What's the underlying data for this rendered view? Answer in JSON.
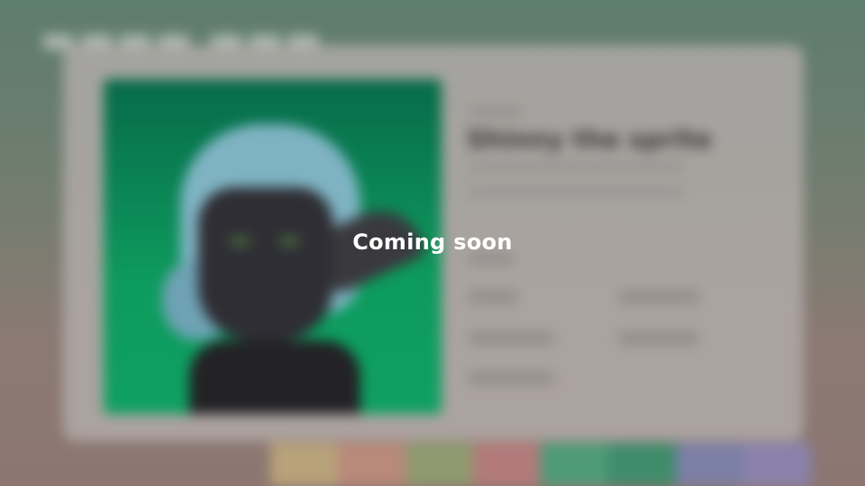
{
  "overlay": {
    "message": "Coming soon"
  },
  "profile": {
    "name": "Shinny the sprite"
  },
  "colors": {
    "art_background": "#0d9a5d",
    "overlay_text": "#ffffff"
  },
  "icons": {
    "artwork": "character-portrait"
  }
}
